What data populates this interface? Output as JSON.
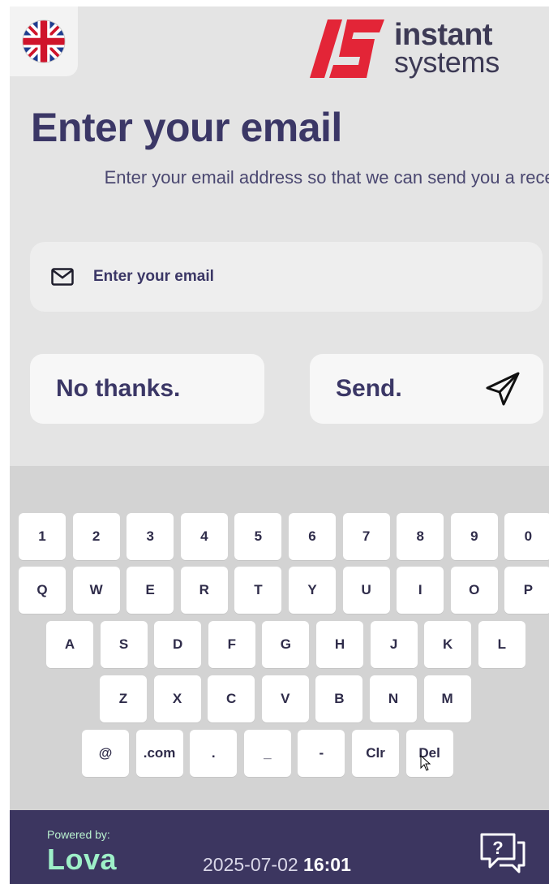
{
  "header": {
    "language_icon": "uk-flag-icon",
    "brand_line1": "instant",
    "brand_line2": "systems",
    "brand_color": "#e32537"
  },
  "main": {
    "title": "Enter your email",
    "subtitle": "Enter your email address so that we can send you a receipt",
    "email_placeholder": "Enter your email",
    "no_thanks_label": "No thanks.",
    "send_label": "Send."
  },
  "keyboard": {
    "rows": [
      [
        "1",
        "2",
        "3",
        "4",
        "5",
        "6",
        "7",
        "8",
        "9",
        "0"
      ],
      [
        "Q",
        "W",
        "E",
        "R",
        "T",
        "Y",
        "U",
        "I",
        "O",
        "P"
      ],
      [
        "A",
        "S",
        "D",
        "F",
        "G",
        "H",
        "J",
        "K",
        "L"
      ],
      [
        "Z",
        "X",
        "C",
        "V",
        "B",
        "N",
        "M"
      ],
      [
        "@",
        ".com",
        ".",
        "_",
        "-",
        "Clr",
        "Del"
      ]
    ]
  },
  "footer": {
    "powered_by": "Powered by:",
    "brand": "Lova",
    "date": "2025-07-02",
    "time": "16:01",
    "help_icon": "help-chat-icon"
  },
  "colors": {
    "primary_text": "#3b3766",
    "footer_bg": "#3c3660",
    "lova_green": "#9ef0c8",
    "screen_bg": "#e4e4e4",
    "keyboard_bg": "#d3d3d3"
  }
}
